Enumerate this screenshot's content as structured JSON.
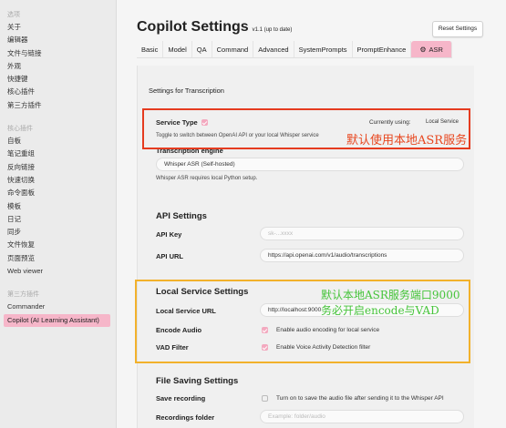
{
  "sidebar": {
    "heading_options": "选项",
    "options": [
      "关于",
      "编辑器",
      "文件与链接",
      "外观",
      "快捷键",
      "核心插件",
      "第三方插件"
    ],
    "heading_core": "核心插件",
    "core": [
      "自板",
      "笔记重组",
      "反向链接",
      "快速切换",
      "命令面板",
      "模板",
      "日记",
      "同步",
      "文件恢复",
      "页面预览",
      "Web viewer"
    ],
    "heading_third": "第三方插件",
    "third": [
      "Commander",
      "Copilot (AI Learning Assistant)"
    ]
  },
  "header": {
    "title": "Copilot Settings",
    "version": "v1.1 (up to date)",
    "reset_label": "Reset Settings"
  },
  "tabs": [
    "Basic",
    "Model",
    "QA",
    "Command",
    "Advanced",
    "SystemPrompts",
    "PromptEnhance",
    "ASR"
  ],
  "content": {
    "settings_for_transcription": "Settings for Transcription",
    "service_type": {
      "label": "Service Type",
      "desc": "Toggle to switch between OpenAI API or your local Whisper service",
      "currently_using_label": "Currently using:",
      "currently_using_value": "Local Service"
    },
    "engine": {
      "label": "Transcription engine",
      "value": "Whisper ASR (Self-hosted)",
      "desc": "Whisper ASR requires local Python setup."
    },
    "api": {
      "heading": "API Settings",
      "key_label": "API Key",
      "key_placeholder": "sk-...xxxx",
      "url_label": "API URL",
      "url_value": "https://api.openai.com/v1/audio/transcriptions"
    },
    "local": {
      "heading": "Local Service Settings",
      "url_label": "Local Service URL",
      "url_value": "http://localhost:9000",
      "encode_label": "Encode Audio",
      "encode_text": "Enable audio encoding for local service",
      "vad_label": "VAD Filter",
      "vad_text": "Enable Voice Activity Detection filter"
    },
    "file_saving": {
      "heading": "File Saving Settings",
      "save_label": "Save recording",
      "save_text": "Turn on to save the audio file after sending it to the Whisper API",
      "folder_label": "Recordings folder",
      "folder_placeholder": "Example: folder/audio"
    }
  },
  "annotations": {
    "red": "默认使用本地ASR服务",
    "green_line1": "默认本地ASR服务端口9000",
    "green_line2": "务必开启encode与VAD"
  },
  "colors": {
    "accent": "#f6b6c9",
    "red_box": "#e53b1f",
    "orange_box": "#f2b12b",
    "annotation_green": "#46c43a"
  }
}
